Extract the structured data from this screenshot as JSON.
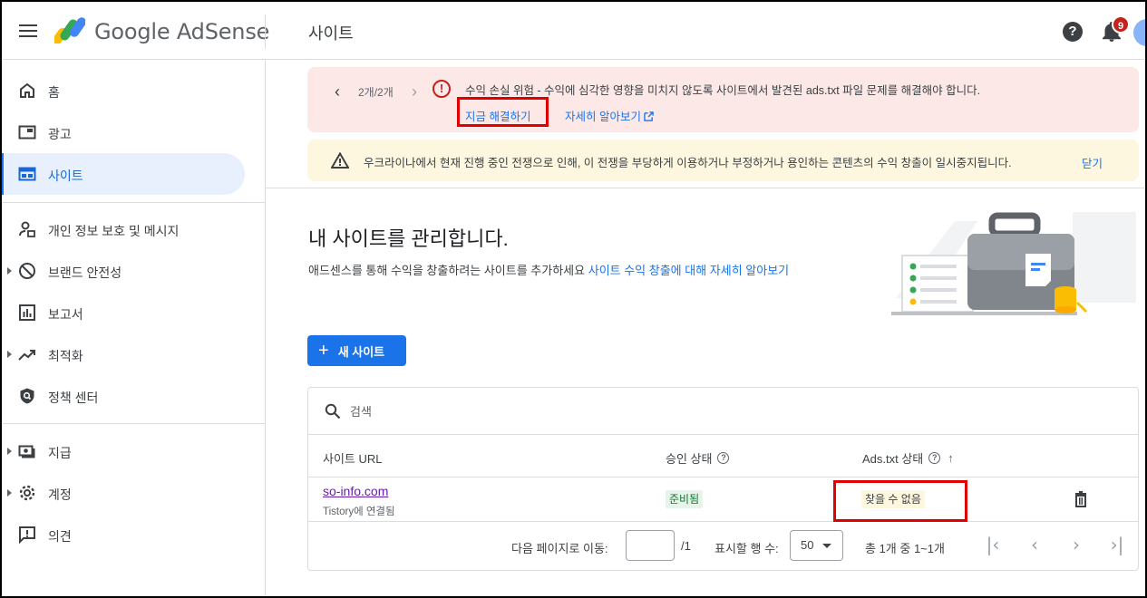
{
  "topbar": {
    "brand_google": "Google",
    "brand_product": "AdSense",
    "page_title": "사이트",
    "help_icon": "?",
    "notification_count": "9"
  },
  "sidebar": {
    "items": [
      {
        "label": "홈",
        "icon": "home-icon"
      },
      {
        "label": "광고",
        "icon": "ads-icon"
      },
      {
        "label": "사이트",
        "icon": "sites-icon",
        "active": true
      },
      {
        "label": "개인 정보 보호 및 메시지",
        "icon": "privacy-icon"
      },
      {
        "label": "브랜드 안전성",
        "icon": "block-icon"
      },
      {
        "label": "보고서",
        "icon": "report-icon"
      },
      {
        "label": "최적화",
        "icon": "trending-icon"
      },
      {
        "label": "정책 센터",
        "icon": "policy-icon"
      },
      {
        "label": "지급",
        "icon": "payments-icon"
      },
      {
        "label": "계정",
        "icon": "settings-icon"
      },
      {
        "label": "의견",
        "icon": "feedback-icon"
      }
    ]
  },
  "alerts": {
    "red": {
      "counter": "2개/2개",
      "message": "수익 손실 위험 - 수익에 심각한 영향을 미치지 않도록 사이트에서 발견된 ads.txt 파일 문제를 해결해야 합니다.",
      "fix_label": "지금 해결하기",
      "learn_label": "자세히 알아보기"
    },
    "yellow": {
      "message": "우크라이나에서 현재 진행 중인 전쟁으로 인해, 이 전쟁을 부당하게 이용하거나 부정하거나 용인하는 콘텐츠의 수익 창출이 일시중지됩니다.",
      "close_label": "닫기"
    }
  },
  "main": {
    "heading": "내 사이트를 관리합니다.",
    "subtext": "애드센스를 통해 수익을 창출하려는 사이트를 추가하세요",
    "sublink": "사이트 수익 창출에 대해 자세히 알아보기",
    "new_site_label": "새 사이트"
  },
  "table": {
    "search_placeholder": "검색",
    "columns": [
      "사이트 URL",
      "승인 상태",
      "Ads.txt 상태"
    ],
    "rows": [
      {
        "url": "so-info.com",
        "sub": "Tistory에 연결됨",
        "approval": "준비됨",
        "ads_txt": "찾을 수 없음"
      }
    ],
    "pager": {
      "go_to_label": "다음 페이지로 이동:",
      "page_total": "/1",
      "rows_label": "표시할 행 수:",
      "rows_value": "50",
      "summary": "총 1개 중 1~1개"
    }
  },
  "colors": {
    "primary": "#1a73e8",
    "alert_red_bg": "#fce8e6",
    "alert_yellow_bg": "#fef7e0",
    "highlight_box": "#e00000"
  }
}
